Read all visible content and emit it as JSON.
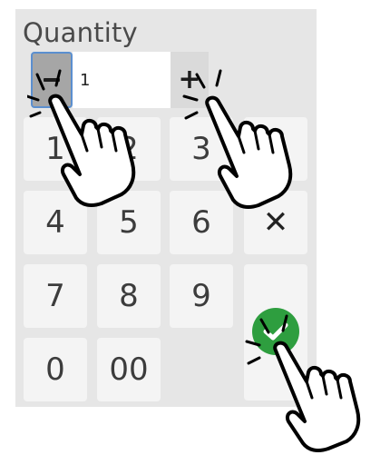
{
  "quantity": {
    "label": "Quantity",
    "value": "1",
    "minus_symbol": "−",
    "plus_symbol": "+"
  },
  "keypad": {
    "keys": [
      "1",
      "2",
      "3",
      "4",
      "5",
      "6",
      "7",
      "8",
      "9",
      "0",
      "00"
    ],
    "clear_icon": "close-icon",
    "clear_symbol": "✕",
    "enter_icon": "check-icon"
  },
  "cursors": [
    "pointer-hand-icon",
    "pointer-hand-icon",
    "pointer-hand-icon"
  ],
  "colors": {
    "panel": "#e6e6e6",
    "key": "#f4f4f4",
    "focus_outline": "#5b8fcf",
    "confirm": "#2e9e3f"
  }
}
